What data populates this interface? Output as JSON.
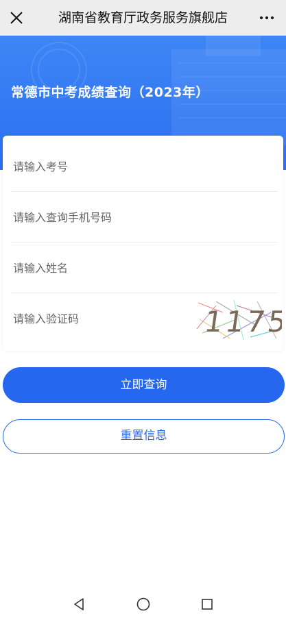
{
  "topbar": {
    "title": "湖南省教育厅政务服务旗舰店",
    "close_icon": "close-icon",
    "more_icon": "more-dots-icon"
  },
  "banner": {
    "title": "常德市中考成绩查询（2023年）"
  },
  "form": {
    "exam_number_placeholder": "请输入考号",
    "phone_placeholder": "请输入查询手机号码",
    "name_placeholder": "请输入姓名",
    "captcha_placeholder": "请输入验证码",
    "captcha_text": "1175"
  },
  "buttons": {
    "query_label": "立即查询",
    "reset_label": "重置信息"
  },
  "colors": {
    "accent": "#2667f0",
    "banner_top": "#3e86f6",
    "topbar_bg": "#ededed"
  },
  "navbar": {
    "icons": [
      "back-triangle-icon",
      "home-circle-icon",
      "recents-square-icon"
    ]
  }
}
